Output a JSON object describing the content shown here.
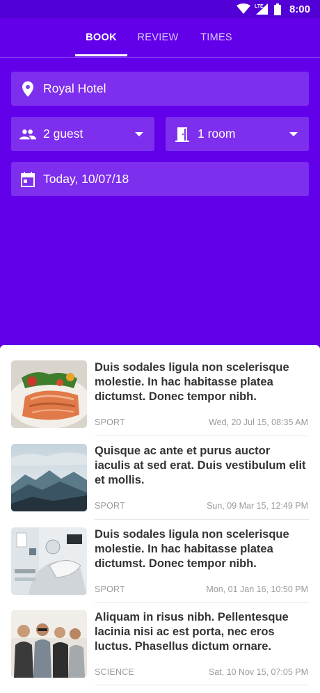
{
  "status_bar": {
    "time": "8:00",
    "network": "LTE",
    "icons": [
      "wifi-icon",
      "signal-icon",
      "battery-icon"
    ]
  },
  "tabs": [
    {
      "label": "BOOK",
      "active": true
    },
    {
      "label": "REVIEW",
      "active": false
    },
    {
      "label": "TIMES",
      "active": false
    }
  ],
  "booking": {
    "location": {
      "icon": "location-pin-icon",
      "value": "Royal Hotel"
    },
    "guests": {
      "icon": "people-icon",
      "value": "2 guest"
    },
    "rooms": {
      "icon": "door-icon",
      "value": "1 room"
    },
    "date": {
      "icon": "calendar-icon",
      "value": "Today, 10/07/18"
    }
  },
  "articles": [
    {
      "title": "Duis sodales ligula non scelerisque molestie. In hac habitasse platea dictumst. Donec tempor nibh.",
      "category": "SPORT",
      "date": "Wed, 20 Jul 15, 08:35 AM",
      "image": "salmon-dish"
    },
    {
      "title": "Quisque ac ante et purus auctor iaculis at sed erat. Duis vestibulum elit et mollis.",
      "category": "SPORT",
      "date": "Sun, 09 Mar 15, 12:49 PM",
      "image": "mountains"
    },
    {
      "title": "Duis sodales ligula non scelerisque molestie. In hac habitasse platea dictumst. Donec tempor nibh.",
      "category": "SPORT",
      "date": "Mon, 01 Jan 16, 10:50 PM",
      "image": "dental-chair"
    },
    {
      "title": "Aliquam in risus nibh. Pellentesque lacinia nisi ac est porta, nec eros luctus. Phasellus dictum ornare.",
      "category": "SCIENCE",
      "date": "Sat, 10 Nov 15, 07:05 PM",
      "image": "group-of-friends"
    }
  ],
  "colors": {
    "primary": "#6200ea",
    "status_bar": "#5200d6",
    "title_text": "#333333",
    "meta_text": "#9a9a9a"
  }
}
